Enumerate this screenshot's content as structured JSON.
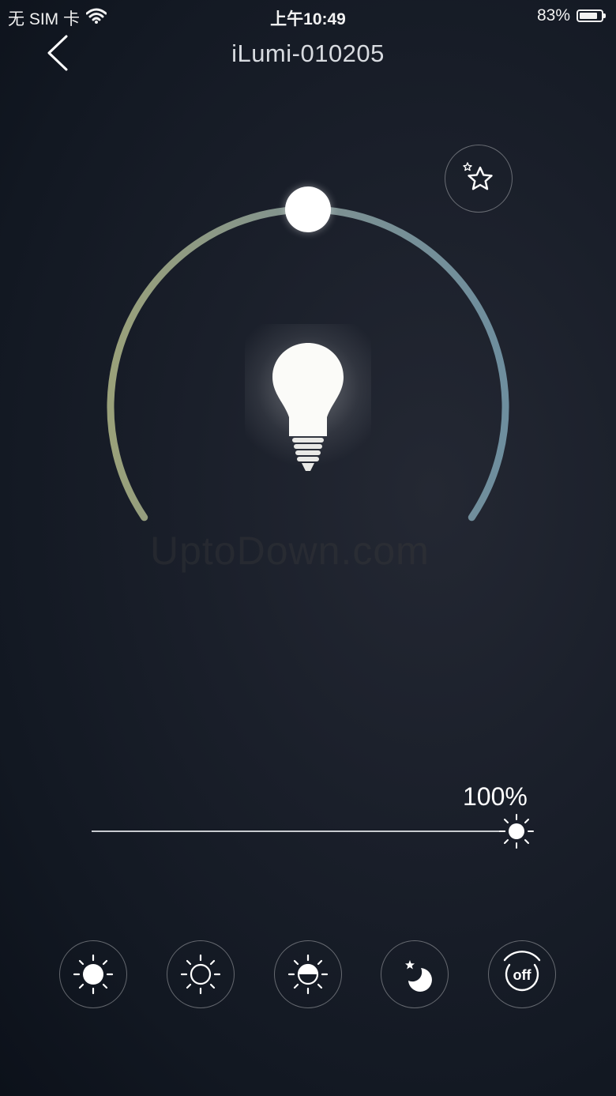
{
  "status_bar": {
    "carrier": "无 SIM 卡",
    "time": "上午10:49",
    "battery_text": "83%",
    "battery_level": 0.83
  },
  "nav": {
    "title": "iLumi-010205"
  },
  "dial": {
    "colors": {
      "warm": "#9aa17a",
      "mid": "#7f9190",
      "cool": "#6e8e9e"
    },
    "knob_position": 0.5
  },
  "watermark": "UptoDown.com",
  "brightness": {
    "label": "100%",
    "value": 1.0
  },
  "modes": [
    {
      "icon": "sun-filled-icon"
    },
    {
      "icon": "sun-outline-icon"
    },
    {
      "icon": "sun-half-icon"
    },
    {
      "icon": "moon-star-icon"
    },
    {
      "icon": "off-icon",
      "label": "off"
    }
  ]
}
